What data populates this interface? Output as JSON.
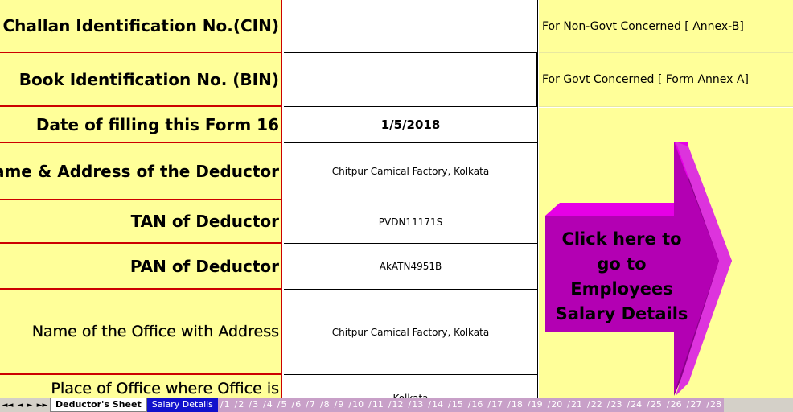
{
  "rows": [
    {
      "label": "Challan Identification No.(CIN)",
      "value": "",
      "right": "For Non-Govt Concerned [ Annex-B]"
    },
    {
      "label": "Book Identification No. (BIN)",
      "value": "",
      "right": "For Govt Concerned [ Form Annex A]"
    },
    {
      "label": "Date of filling this Form 16",
      "value": "1/5/2018"
    },
    {
      "label": "Name & Address of the Deductor",
      "value": "Chitpur Camical Factory, Kolkata"
    },
    {
      "label": "TAN of Deductor",
      "value": "PVDN11171S"
    },
    {
      "label": "PAN of Deductor",
      "value": "AkATN4951B"
    },
    {
      "label": "Name of the Office with Address",
      "value": "Chitpur Camical Factory, Kolkata"
    },
    {
      "label": "Place of Office where Office is",
      "value": "Kolkata"
    }
  ],
  "arrow_button": {
    "line1": "Click here to",
    "line2": "go to",
    "line3": "Employees",
    "line4": "Salary Details",
    "color": "#cc00cc"
  },
  "tabs": {
    "nav": [
      "◄◄",
      "◄",
      "►",
      "►►"
    ],
    "active": "Deductor's Sheet",
    "blue": "Salary Details",
    "numbered": [
      "1",
      "2",
      "3",
      "4",
      "5",
      "6",
      "7",
      "8",
      "9",
      "10",
      "11",
      "12",
      "13",
      "14",
      "15",
      "16",
      "17",
      "18",
      "19",
      "20",
      "21",
      "22",
      "23",
      "24",
      "25",
      "26",
      "27",
      "28"
    ]
  },
  "colors": {
    "cell_yellow": "#ffff99",
    "border_red": "#cc0000",
    "tab_blue": "#1111cc"
  }
}
